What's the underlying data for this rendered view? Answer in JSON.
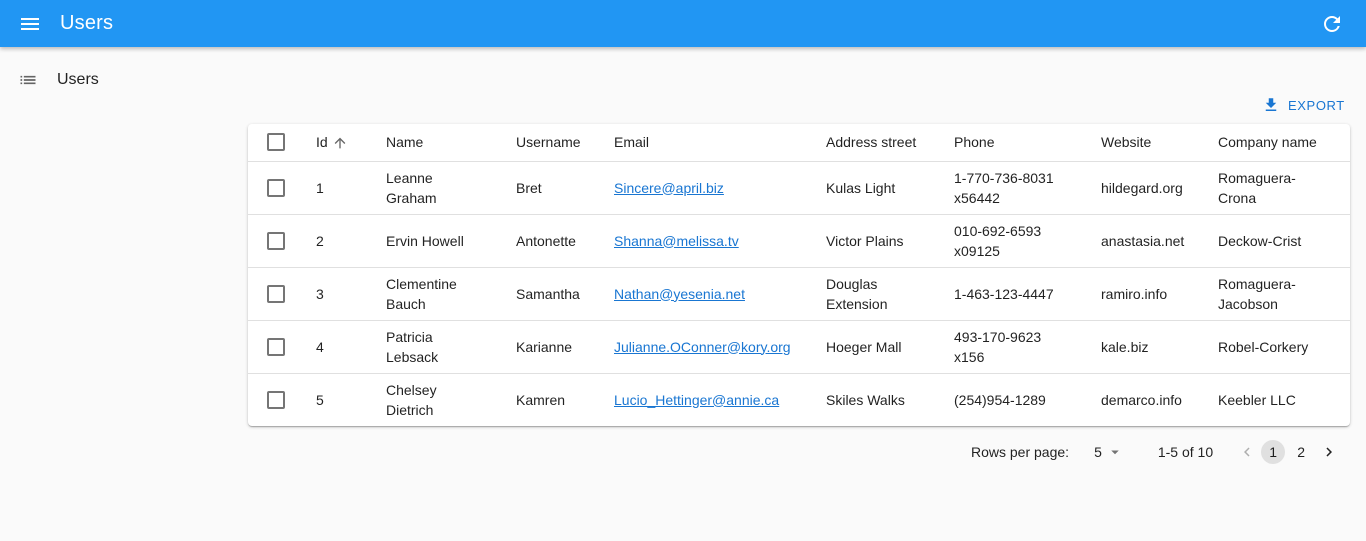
{
  "appbar": {
    "title": "Users"
  },
  "sidebar": {
    "items": [
      {
        "label": "Users"
      }
    ]
  },
  "toolbar": {
    "export_label": "Export"
  },
  "table": {
    "columns": [
      "Id",
      "Name",
      "Username",
      "Email",
      "Address street",
      "Phone",
      "Website",
      "Company name"
    ],
    "rows": [
      {
        "id": "1",
        "name": "Leanne Graham",
        "username": "Bret",
        "email": "Sincere@april.biz",
        "street": "Kulas Light",
        "phone": "1-770-736-8031 x56442",
        "website": "hildegard.org",
        "company": "Romaguera-Crona"
      },
      {
        "id": "2",
        "name": "Ervin Howell",
        "username": "Antonette",
        "email": "Shanna@melissa.tv",
        "street": "Victor Plains",
        "phone": "010-692-6593 x09125",
        "website": "anastasia.net",
        "company": "Deckow-Crist"
      },
      {
        "id": "3",
        "name": "Clementine Bauch",
        "username": "Samantha",
        "email": "Nathan@yesenia.net",
        "street": "Douglas Extension",
        "phone": "1-463-123-4447",
        "website": "ramiro.info",
        "company": "Romaguera-Jacobson"
      },
      {
        "id": "4",
        "name": "Patricia Lebsack",
        "username": "Karianne",
        "email": "Julianne.OConner@kory.org",
        "street": "Hoeger Mall",
        "phone": "493-170-9623 x156",
        "website": "kale.biz",
        "company": "Robel-Corkery"
      },
      {
        "id": "5",
        "name": "Chelsey Dietrich",
        "username": "Kamren",
        "email": "Lucio_Hettinger@annie.ca",
        "street": "Skiles Walks",
        "phone": "(254)954-1289",
        "website": "demarco.info",
        "company": "Keebler LLC"
      }
    ]
  },
  "pagination": {
    "rows_per_page_label": "Rows per page:",
    "rows_per_page": "5",
    "range": "1-5 of 10",
    "pages": [
      "1",
      "2"
    ]
  },
  "icons": {
    "menu": "menu-icon",
    "refresh": "refresh-icon",
    "list": "list-icon",
    "export": "download-icon",
    "sort": "arrow-upward-icon"
  },
  "colors": {
    "appbar": "#2196f3",
    "link": "#1976d2"
  }
}
